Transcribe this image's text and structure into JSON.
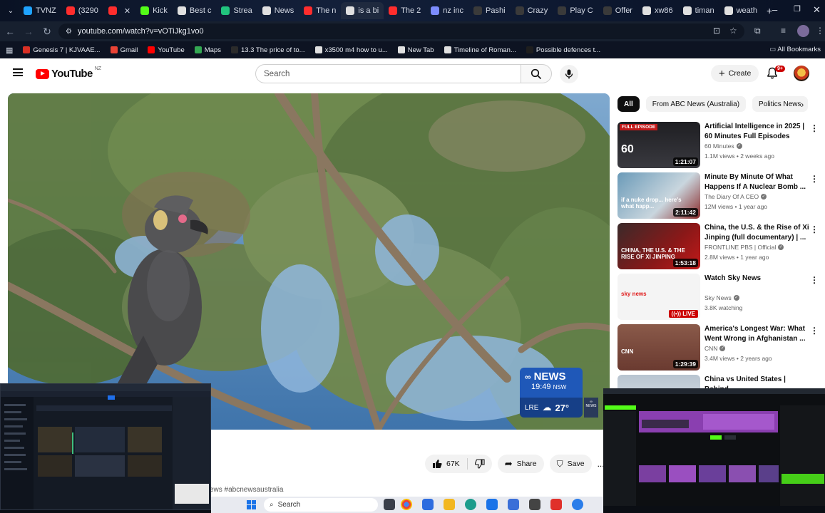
{
  "browser": {
    "tabs": [
      {
        "label": "TVNZ",
        "color": "#1fa3ff"
      },
      {
        "label": "(3290",
        "color": "#ff2d2d"
      },
      {
        "label": "",
        "color": "#ff2d2d"
      },
      {
        "label": "Kick",
        "color": "#53fc18"
      },
      {
        "label": "Best c",
        "color": "#e0e0e0"
      },
      {
        "label": "Strea",
        "color": "#21c47e"
      },
      {
        "label": "News",
        "color": "#e0e0e0"
      },
      {
        "label": "The n",
        "color": "#ff2d2d"
      },
      {
        "label": "is a bi",
        "color": "#e0e0e0"
      },
      {
        "label": "The 2",
        "color": "#ff2d2d"
      },
      {
        "label": "nz inc",
        "color": "#7c8cff"
      },
      {
        "label": "Pashi",
        "color": "#3a3a3a"
      },
      {
        "label": "Crazy",
        "color": "#3a3a3a"
      },
      {
        "label": "Play C",
        "color": "#3a3a3a"
      },
      {
        "label": "Offer",
        "color": "#3a3a3a"
      },
      {
        "label": "xw86",
        "color": "#e0e0e0"
      },
      {
        "label": "timan",
        "color": "#e0e0e0"
      },
      {
        "label": "weath",
        "color": "#e0e0e0"
      }
    ],
    "new_tab_symbol": "+",
    "url": "youtube.com/watch?v=vOTiJkg1vo0",
    "bookmarks": [
      {
        "label": "Genesis 7 | KJVAAE...",
        "color": "#d93025"
      },
      {
        "label": "Gmail",
        "color": "#ea4335"
      },
      {
        "label": "YouTube",
        "color": "#ff0000"
      },
      {
        "label": "Maps",
        "color": "#34a853"
      },
      {
        "label": "13.3 The price of to...",
        "color": "#2b2b2b"
      },
      {
        "label": "x3500 m4 how to u...",
        "color": "#e0e0e0"
      },
      {
        "label": "New Tab",
        "color": "#e0e0e0"
      },
      {
        "label": "Timeline of Roman...",
        "color": "#e0e0e0"
      },
      {
        "label": "Possible defences t...",
        "color": "#1e1e1e"
      }
    ],
    "all_bookmarks": "All Bookmarks"
  },
  "youtube": {
    "logo_text": "YouTube",
    "country_code": "NZ",
    "search_placeholder": "Search",
    "create_label": "Create",
    "notifications_badge": "9+",
    "video_overlay": {
      "brand": "NEWS",
      "time": "19:49",
      "timezone": "NSW",
      "weather_location": "LRE",
      "temperature": "27°"
    },
    "actions": {
      "likes": "67K",
      "share": "Share",
      "save": "Save",
      "more": "..."
    },
    "hashtag_text": "ews #abcnewsaustralia",
    "chips": [
      "All",
      "From ABC News (Australia)",
      "Politics News"
    ],
    "related": [
      {
        "title": "Artificial Intelligence in 2025 | 60 Minutes Full Episodes",
        "channel": "60 Minutes",
        "meta": "1.1M views • 2 weeks ago",
        "duration": "1:21:07",
        "badge": "FULL EPISODE",
        "thumb_text": "60"
      },
      {
        "title": "Minute By Minute Of What Happens If A Nuclear Bomb ...",
        "channel": "The Diary Of A CEO",
        "meta": "12M views • 1 year ago",
        "duration": "2:11:42",
        "thumb_text": "if a nuke drop... here's what happ..."
      },
      {
        "title": "China, the U.S. & the Rise of Xi Jinping (full documentary) | ...",
        "channel": "FRONTLINE PBS | Official",
        "meta": "2.8M views • 1 year ago",
        "duration": "1:53:18",
        "thumb_text": "CHINA, THE U.S. & THE RISE OF XI JINPING"
      },
      {
        "title": "Watch Sky News",
        "channel": "Sky News",
        "meta": "3.8K watching",
        "live": "LIVE",
        "thumb_text": "sky news"
      },
      {
        "title": "America's Longest War: What Went Wrong in Afghanistan ...",
        "channel": "CNN",
        "meta": "3.4M views • 2 years ago",
        "duration": "1:29:39",
        "thumb_text": "CNN"
      },
      {
        "title": "China vs United States | Behind",
        "channel": "",
        "meta": "",
        "duration": ""
      }
    ]
  },
  "taskbar": {
    "search_label": "Search"
  }
}
